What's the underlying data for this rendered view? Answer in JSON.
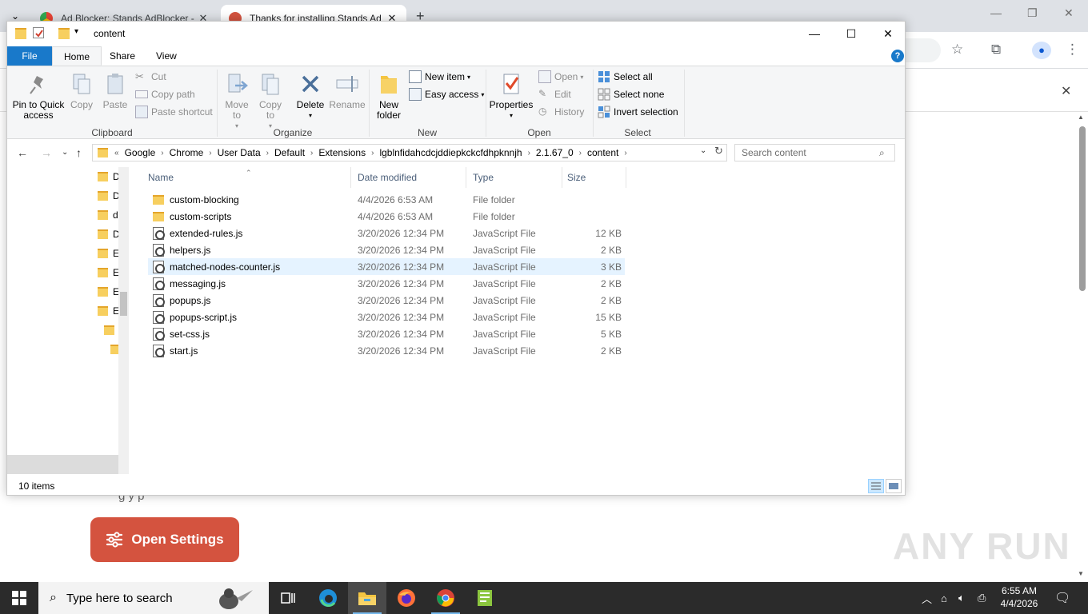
{
  "chrome": {
    "tabs": [
      {
        "title": "Ad Blocker: Stands AdBlocker -"
      },
      {
        "title": "Thanks for installing Stands Ad"
      }
    ],
    "open_settings_label": "Open Settings",
    "watermark": "ANY RUN",
    "partial_text": "g          y              p"
  },
  "explorer": {
    "title": "content",
    "ribbon_tabs": [
      "File",
      "Home",
      "Share",
      "View"
    ],
    "clipboard": {
      "pin": "Pin to Quick access",
      "copy": "Copy",
      "paste": "Paste",
      "cut": "Cut",
      "copy_path": "Copy path",
      "paste_shortcut": "Paste shortcut",
      "label": "Clipboard"
    },
    "organize": {
      "move_to": "Move to",
      "copy_to": "Copy to",
      "delete": "Delete",
      "rename": "Rename",
      "label": "Organize"
    },
    "new_group": {
      "new_folder": "New folder",
      "new_item": "New item",
      "easy_access": "Easy access",
      "label": "New"
    },
    "open_group": {
      "properties": "Properties",
      "open": "Open",
      "edit": "Edit",
      "history": "History",
      "label": "Open"
    },
    "select_group": {
      "select_all": "Select all",
      "select_none": "Select none",
      "invert": "Invert selection",
      "label": "Select"
    },
    "breadcrumb": [
      "Google",
      "Chrome",
      "User Data",
      "Default",
      "Extensions",
      "lgblnfidahcdcjddiepkckcfdhpknnjh",
      "2.1.67_0",
      "content"
    ],
    "search_placeholder": "Search content",
    "nav_items": [
      "D",
      "D",
      "d",
      "D",
      "E",
      "E",
      "E",
      "E"
    ],
    "columns": [
      "Name",
      "Date modified",
      "Type",
      "Size"
    ],
    "files": [
      {
        "name": "custom-blocking",
        "date": "4/4/2026 6:53 AM",
        "type": "File folder",
        "size": "",
        "kind": "folder"
      },
      {
        "name": "custom-scripts",
        "date": "4/4/2026 6:53 AM",
        "type": "File folder",
        "size": "",
        "kind": "folder"
      },
      {
        "name": "extended-rules.js",
        "date": "3/20/2026 12:34 PM",
        "type": "JavaScript File",
        "size": "12 KB",
        "kind": "js"
      },
      {
        "name": "helpers.js",
        "date": "3/20/2026 12:34 PM",
        "type": "JavaScript File",
        "size": "2 KB",
        "kind": "js"
      },
      {
        "name": "matched-nodes-counter.js",
        "date": "3/20/2026 12:34 PM",
        "type": "JavaScript File",
        "size": "3 KB",
        "kind": "js"
      },
      {
        "name": "messaging.js",
        "date": "3/20/2026 12:34 PM",
        "type": "JavaScript File",
        "size": "2 KB",
        "kind": "js"
      },
      {
        "name": "popups.js",
        "date": "3/20/2026 12:34 PM",
        "type": "JavaScript File",
        "size": "2 KB",
        "kind": "js"
      },
      {
        "name": "popups-script.js",
        "date": "3/20/2026 12:34 PM",
        "type": "JavaScript File",
        "size": "15 KB",
        "kind": "js"
      },
      {
        "name": "set-css.js",
        "date": "3/20/2026 12:34 PM",
        "type": "JavaScript File",
        "size": "5 KB",
        "kind": "js"
      },
      {
        "name": "start.js",
        "date": "3/20/2026 12:34 PM",
        "type": "JavaScript File",
        "size": "2 KB",
        "kind": "js"
      }
    ],
    "selected_index": 4,
    "status": "10 items"
  },
  "taskbar": {
    "search_placeholder": "Type here to search",
    "time": "6:55 AM",
    "date": "4/4/2026"
  },
  "colors": {
    "file_tab": "#1979ca",
    "selection": "#e5f3ff",
    "settings_button": "#d4533f",
    "taskbar": "#2b2b2b"
  }
}
